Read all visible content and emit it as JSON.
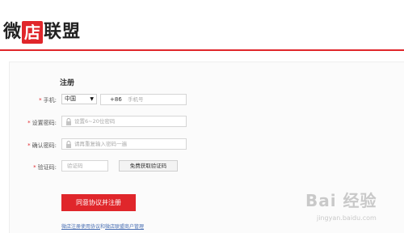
{
  "brand": {
    "char1": "微",
    "boxed": "店",
    "rest": "联盟"
  },
  "form": {
    "title": "注册",
    "phone_label": "手机:",
    "country_value": "中国",
    "country_code": "+86",
    "phone_placeholder": "手机号",
    "password_label": "设置密码:",
    "password_placeholder": "设置6~20位密码",
    "confirm_label": "确认密码:",
    "confirm_placeholder": "请再重复输入密码一遍",
    "captcha_label": "验证码:",
    "captcha_placeholder": "验证码",
    "get_code_button": "免费获取验证码",
    "submit_button": "同意协议并注册",
    "agreement_link1": "微店注册使用协议",
    "agreement_and": "和",
    "agreement_link2": "微店联盟商户管理"
  },
  "watermark": {
    "text": "Bai 经验",
    "sub": "jingyan.baidu.com"
  },
  "colors": {
    "accent": "#e0262b",
    "link": "#4a6fb3"
  }
}
